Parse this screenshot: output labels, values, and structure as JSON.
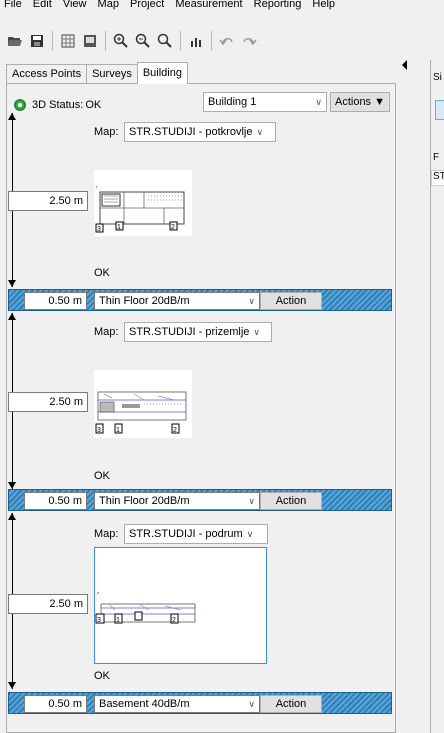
{
  "menu": [
    "File",
    "Edit",
    "View",
    "Map",
    "Project",
    "Measurement",
    "Reporting",
    "Help"
  ],
  "toolbar_icons": [
    "open-folder-icon",
    "save-icon",
    "grid-icon",
    "screen-icon",
    "zoom-in-icon",
    "zoom-out-icon",
    "zoom-fit-icon",
    "chart-icon",
    "undo-icon",
    "redo-icon"
  ],
  "tabs": [
    "Access Points",
    "Surveys",
    "Building"
  ],
  "active_tab": "Building",
  "status": {
    "label": "3D Status:",
    "value": "OK"
  },
  "building_select": "Building 1",
  "actions_button": "Actions ▼",
  "map_label": "Map:",
  "floors": [
    {
      "height": "2.50",
      "unit": "m",
      "map": "STR.STUDIJI - potkrovlje",
      "status": "OK"
    },
    {
      "height": "2.50",
      "unit": "m",
      "map": "STR.STUDIJI - prizemlje",
      "status": "OK"
    },
    {
      "height": "2.50",
      "unit": "m",
      "map": "STR.STUDIJI - podrum",
      "status": "OK"
    }
  ],
  "separators": [
    {
      "thickness": "0.50",
      "unit": "m",
      "material": "Thin Floor 20dB/m",
      "action": "Action"
    },
    {
      "thickness": "0.50",
      "unit": "m",
      "material": "Thin Floor 20dB/m",
      "action": "Action"
    },
    {
      "thickness": "0.50",
      "unit": "m",
      "material": "Basement 40dB/m",
      "action": "Action"
    }
  ],
  "right_pane": {
    "header": "Si",
    "row1": "F",
    "row2": "ST"
  },
  "colors": {
    "floor_band": "#2f7fb6",
    "ok_green": "#33b24a",
    "selected_border": "#3d8ed6"
  }
}
